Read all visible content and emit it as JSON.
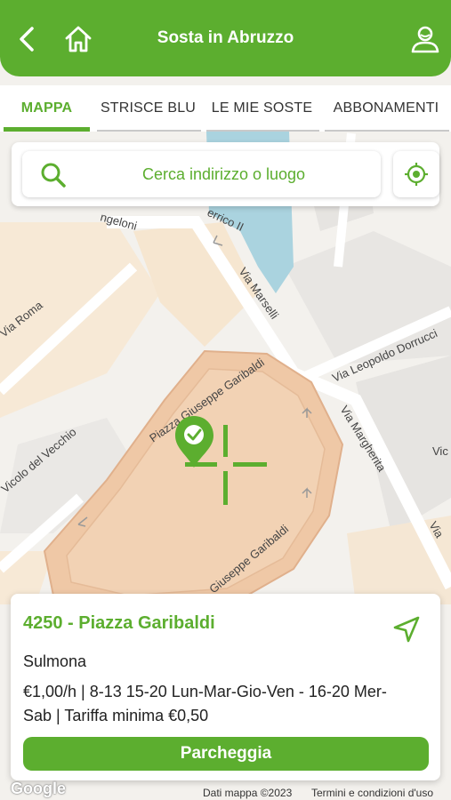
{
  "header": {
    "title": "Sosta in Abruzzo",
    "back_icon": "chevron-left-icon",
    "home_icon": "home-icon",
    "profile_icon": "user-icon",
    "color": "#5cae2f"
  },
  "tabs": [
    {
      "label": "MAPPA",
      "active": true
    },
    {
      "label": "STRISCE BLU",
      "active": false
    },
    {
      "label": "LE MIE SOSTE",
      "active": false
    },
    {
      "label": "ABBONAMENTI",
      "active": false
    }
  ],
  "search": {
    "placeholder": "Cerca indirizzo o luogo",
    "icon": "search-icon",
    "locate_icon": "crosshair-icon"
  },
  "map": {
    "streets": {
      "roma": "Via Roma",
      "marselli": "Via Marselli",
      "dorrucci": "Via Leopoldo Dorrucci",
      "margherita": "Via Margherita",
      "vecchio": "Vicolo del Vecchio",
      "piazza_top": "Piazza Giuseppe Garibaldi",
      "piazza_bottom": "Giuseppe Garibaldi",
      "ngeloni": "ngeloni",
      "errico": "errico II",
      "vic": "Vic",
      "via_right": "Via"
    },
    "marker_icon": "parking-check-marker-icon",
    "crosshair_icon": "map-crosshair-icon"
  },
  "zone_card": {
    "title": "4250 - Piazza Garibaldi",
    "city": "Sulmona",
    "tariff": "€1,00/h | 8-13 15-20 Lun-Mar-Gio-Ven - 16-20 Mer-Sab | Tariffa minima €0,50",
    "navigate_icon": "navigate-arrow-icon",
    "park_button": "Parcheggia"
  },
  "footer": {
    "google": "Google",
    "attribution": "Dati mappa ©2023",
    "terms": "Termini e condizioni d'uso"
  }
}
